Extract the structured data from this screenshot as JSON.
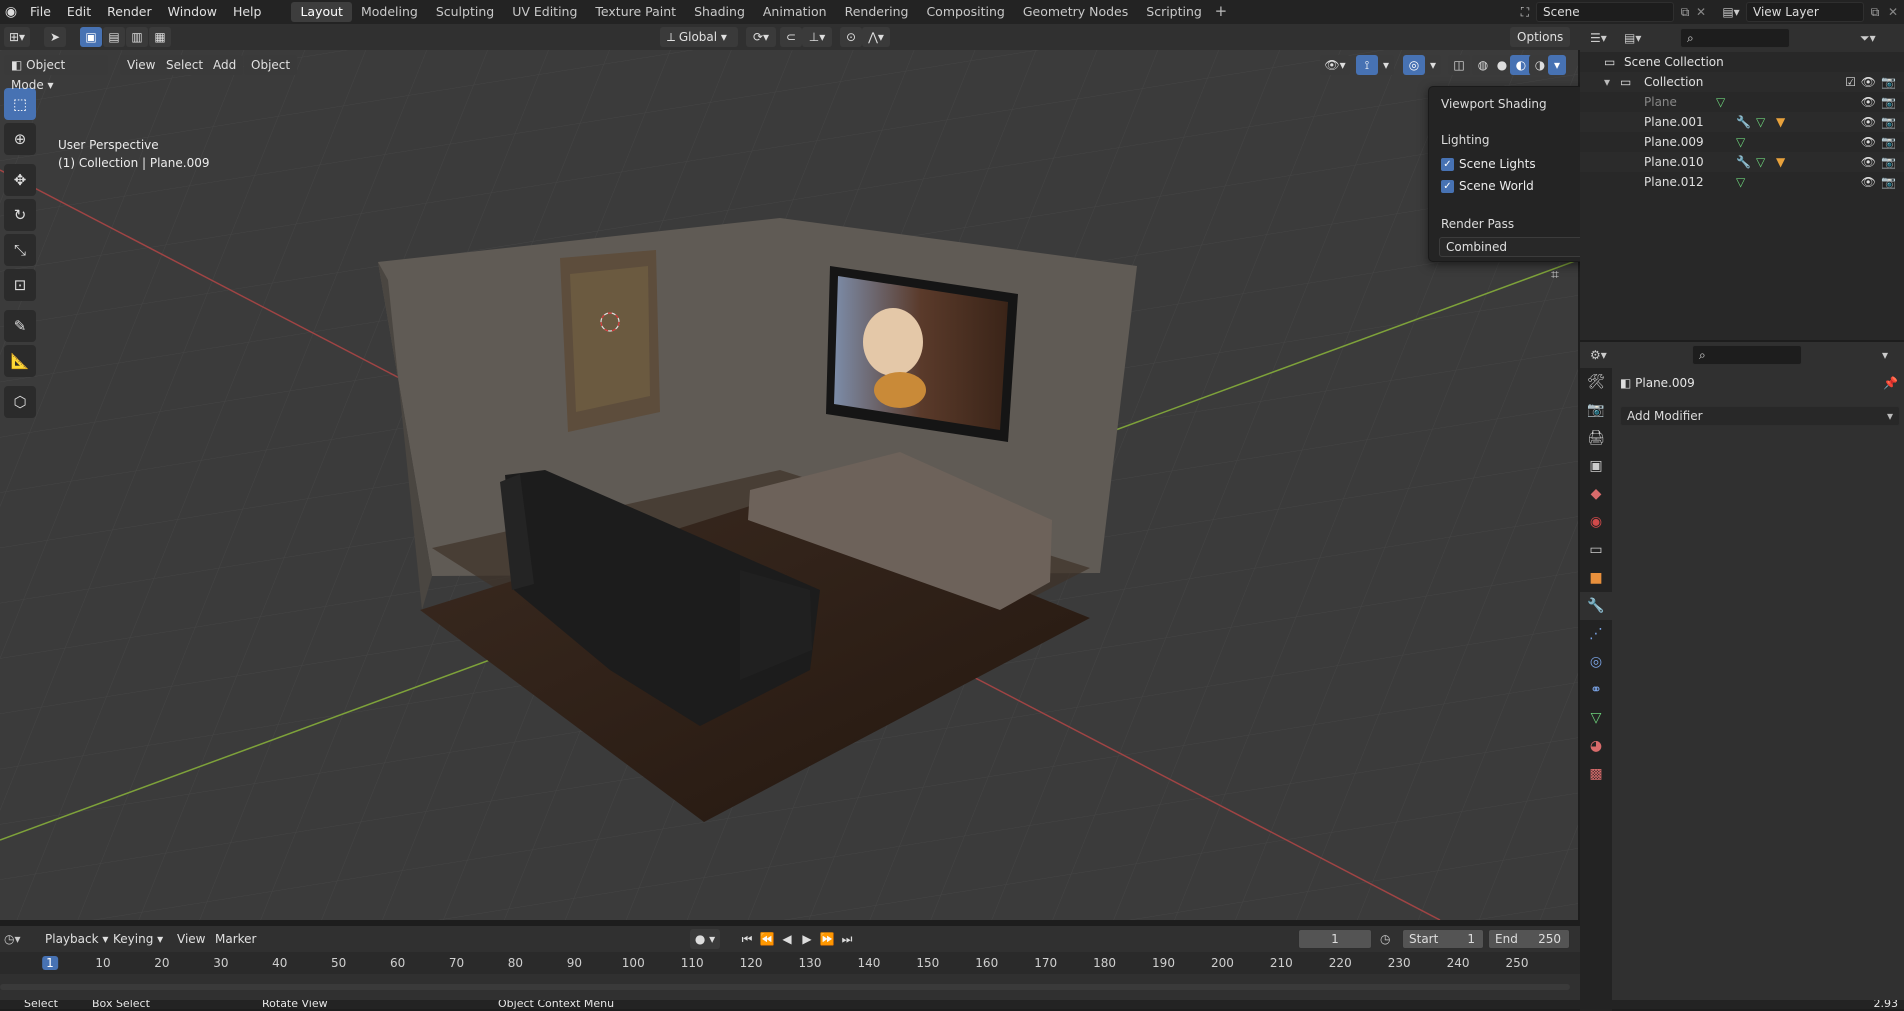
{
  "menu": [
    "File",
    "Edit",
    "Render",
    "Window",
    "Help"
  ],
  "workspaces": [
    "Layout",
    "Modeling",
    "Sculpting",
    "UV Editing",
    "Texture Paint",
    "Shading",
    "Animation",
    "Rendering",
    "Compositing",
    "Geometry Nodes",
    "Scripting"
  ],
  "active_workspace": "Layout",
  "scene": "Scene",
  "view_layer": "View Layer",
  "header": {
    "transform_orientation": "Global",
    "options": "Options",
    "mode": "Object Mode",
    "view": "View",
    "select": "Select",
    "add": "Add",
    "object": "Object"
  },
  "viewport": {
    "perspective": "User Perspective",
    "collection_info": "(1) Collection | Plane.009"
  },
  "shading_popup": {
    "title": "Viewport Shading",
    "lighting": "Lighting",
    "scene_lights": "Scene Lights",
    "scene_world": "Scene World",
    "render_pass_label": "Render Pass",
    "render_pass": "Combined"
  },
  "outliner": {
    "scene_collection": "Scene Collection",
    "collection": "Collection",
    "items": [
      "Plane",
      "Plane.001",
      "Plane.009",
      "Plane.010",
      "Plane.012"
    ]
  },
  "properties": {
    "object_name": "Plane.009",
    "add_modifier": "Add Modifier"
  },
  "timeline": {
    "playback": "Playback",
    "keying": "Keying",
    "view": "View",
    "marker": "Marker",
    "current_frame": "1",
    "start_label": "Start",
    "start": "1",
    "end_label": "End",
    "end": "250",
    "ticks": [
      "1",
      "10",
      "20",
      "30",
      "40",
      "50",
      "60",
      "70",
      "80",
      "90",
      "100",
      "110",
      "120",
      "130",
      "140",
      "150",
      "160",
      "170",
      "180",
      "190",
      "200",
      "210",
      "220",
      "230",
      "240",
      "250"
    ]
  },
  "status": {
    "select": "Select",
    "box_select": "Box Select",
    "rotate_view": "Rotate View",
    "context_menu": "Object Context Menu",
    "version": "2.93"
  },
  "colors": {
    "accent": "#4772b3",
    "x_axis": "#b54545",
    "y_axis": "#7ea23a",
    "mesh_icon": "#6cd17a",
    "modifier_icon": "#e8a23c"
  }
}
